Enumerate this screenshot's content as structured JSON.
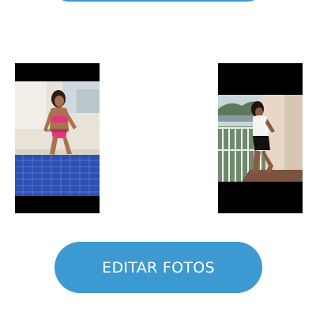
{
  "top_button": {
    "label": ""
  },
  "photos": [
    {
      "icon": "photo-thumbnail"
    },
    {
      "icon": "photo-thumbnail"
    }
  ],
  "edit_button": {
    "label": "EDITAR FOTOS"
  },
  "colors": {
    "accent": "#3d99d1",
    "background": "#ffffff",
    "letterbox": "#000000"
  }
}
